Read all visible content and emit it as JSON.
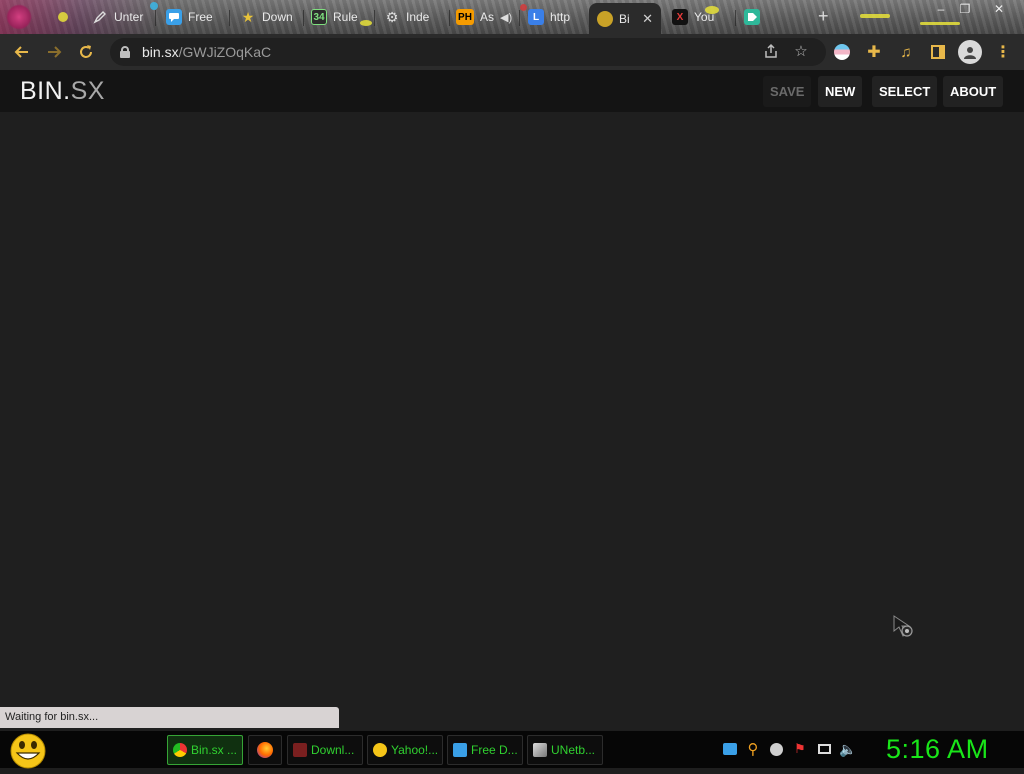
{
  "browser": {
    "tabs": [
      {
        "label": "Unter",
        "icon": "pen-icon",
        "active": false
      },
      {
        "label": "Free ",
        "icon": "chat-icon",
        "active": false
      },
      {
        "label": "Down",
        "icon": "star-icon",
        "active": false
      },
      {
        "label": "Rule",
        "icon": "34-icon",
        "favicon_text": "34",
        "active": false
      },
      {
        "label": "Inde",
        "icon": "gear-icon",
        "active": false
      },
      {
        "label": "As",
        "icon": "ph-icon",
        "favicon_text": "PH",
        "active": false
      },
      {
        "label": "http",
        "icon": "l-icon",
        "favicon_text": "L",
        "active": false
      },
      {
        "label": "Bi",
        "icon": "bin-icon",
        "active": true
      },
      {
        "label": "You",
        "icon": "x-icon",
        "favicon_text": "X",
        "active": false
      },
      {
        "label": "",
        "icon": "tag-icon",
        "active": false
      }
    ],
    "url": {
      "host": "bin.sx",
      "path": "/GWJiZOqKaC"
    },
    "new_tab_symbol": "+",
    "window_controls": {
      "minimize": "–",
      "restore": "❐",
      "close": "✕"
    }
  },
  "site": {
    "logo_main": "BIN.",
    "logo_suffix": "SX",
    "buttons": {
      "save": "SAVE",
      "new": "NEW",
      "select": "SELECT",
      "about": "ABOUT"
    }
  },
  "status": {
    "text": "Waiting for bin.sx..."
  },
  "taskbar": {
    "items": [
      {
        "label": "Bin.sx ...",
        "icon": "chrome-icon",
        "active": true
      },
      {
        "label": "",
        "icon": "firefox-icon",
        "active": false
      },
      {
        "label": "Downl...",
        "icon": "download-icon",
        "active": false
      },
      {
        "label": "Yahoo!...",
        "icon": "yahoo-smiley-icon",
        "active": false
      },
      {
        "label": "Free D...",
        "icon": "chat-icon",
        "active": false
      },
      {
        "label": "UNetb...",
        "icon": "unetbootin-icon",
        "active": false
      }
    ],
    "clock": "5:16 AM"
  },
  "colors": {
    "accent": "#e8b84a",
    "taskbar_text": "#30d130",
    "clock": "#19e619"
  }
}
